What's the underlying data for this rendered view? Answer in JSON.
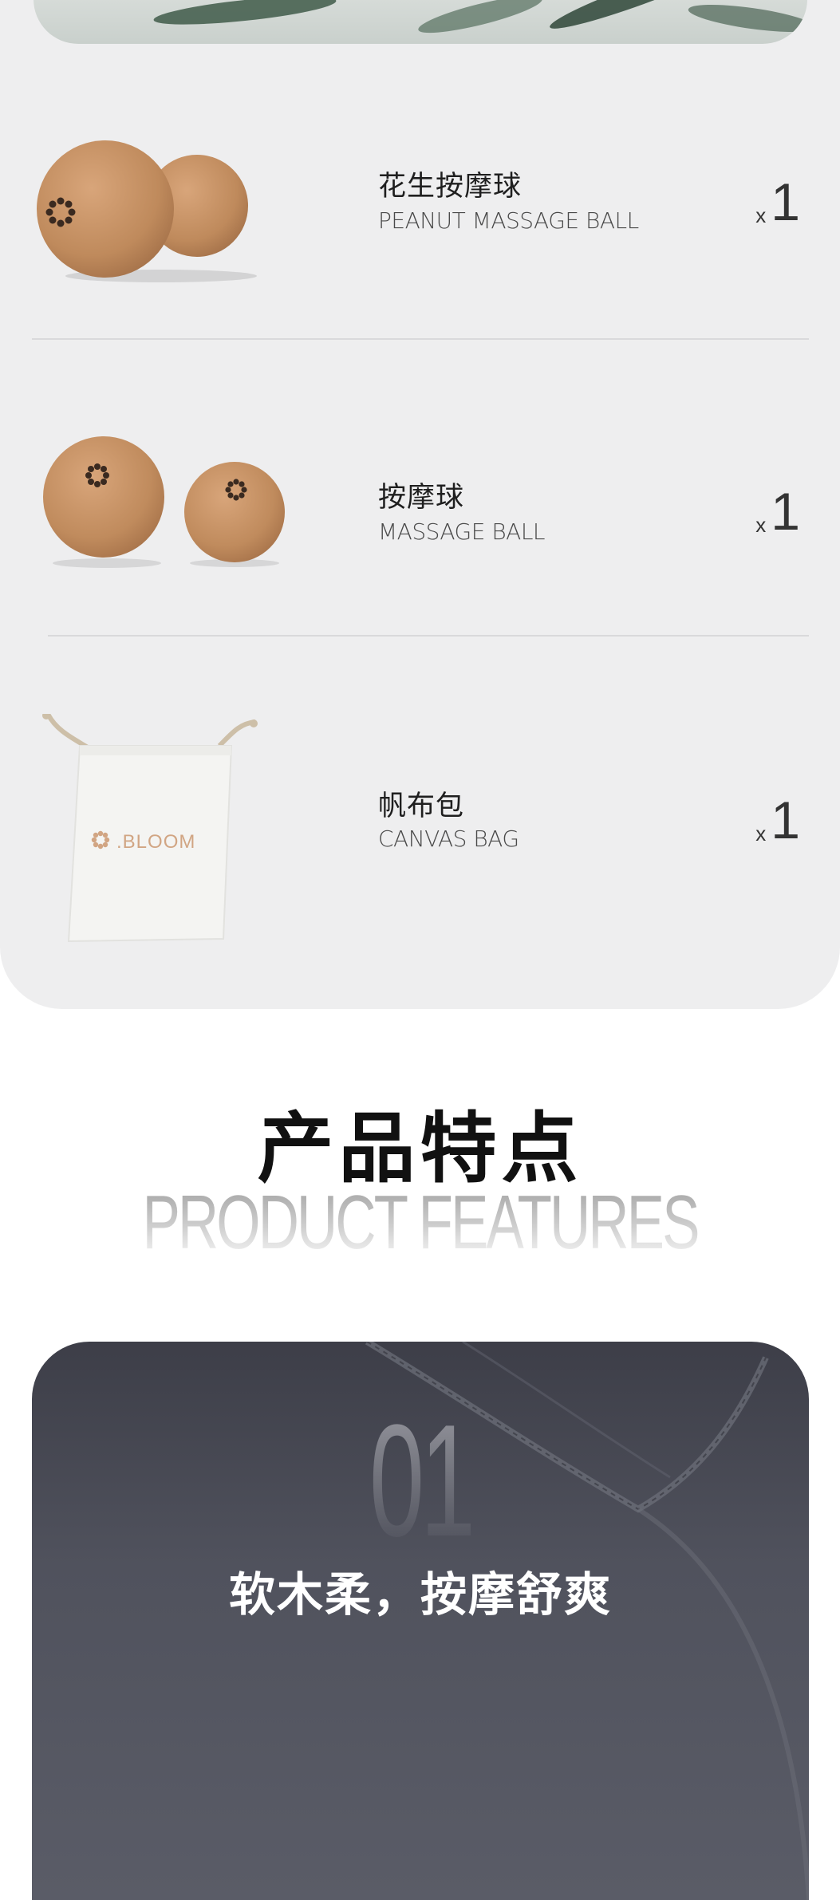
{
  "kit": {
    "items": [
      {
        "name_cn": "花生按摩球",
        "name_en": "PEANUT MASSAGE BALL",
        "qty_prefix": "x",
        "qty": "1",
        "image": "peanut-massage-ball"
      },
      {
        "name_cn": "按摩球",
        "name_en": "MASSAGE BALL",
        "qty_prefix": "x",
        "qty": "1",
        "image": "massage-ball-pair"
      },
      {
        "name_cn": "帆布包",
        "name_en": "CANVAS BAG",
        "qty_prefix": "x",
        "qty": "1",
        "image": "canvas-bag",
        "bag_logo": "BLOOM"
      }
    ]
  },
  "features": {
    "title_cn": "产品特点",
    "title_en": "PRODUCT FEATURES",
    "cards": [
      {
        "number": "01",
        "text": "软木柔，按摩舒爽"
      }
    ]
  },
  "colors": {
    "panel_bg": "#eeeeef",
    "cork": "#c08a5c",
    "card_bg": "#4e505b"
  }
}
